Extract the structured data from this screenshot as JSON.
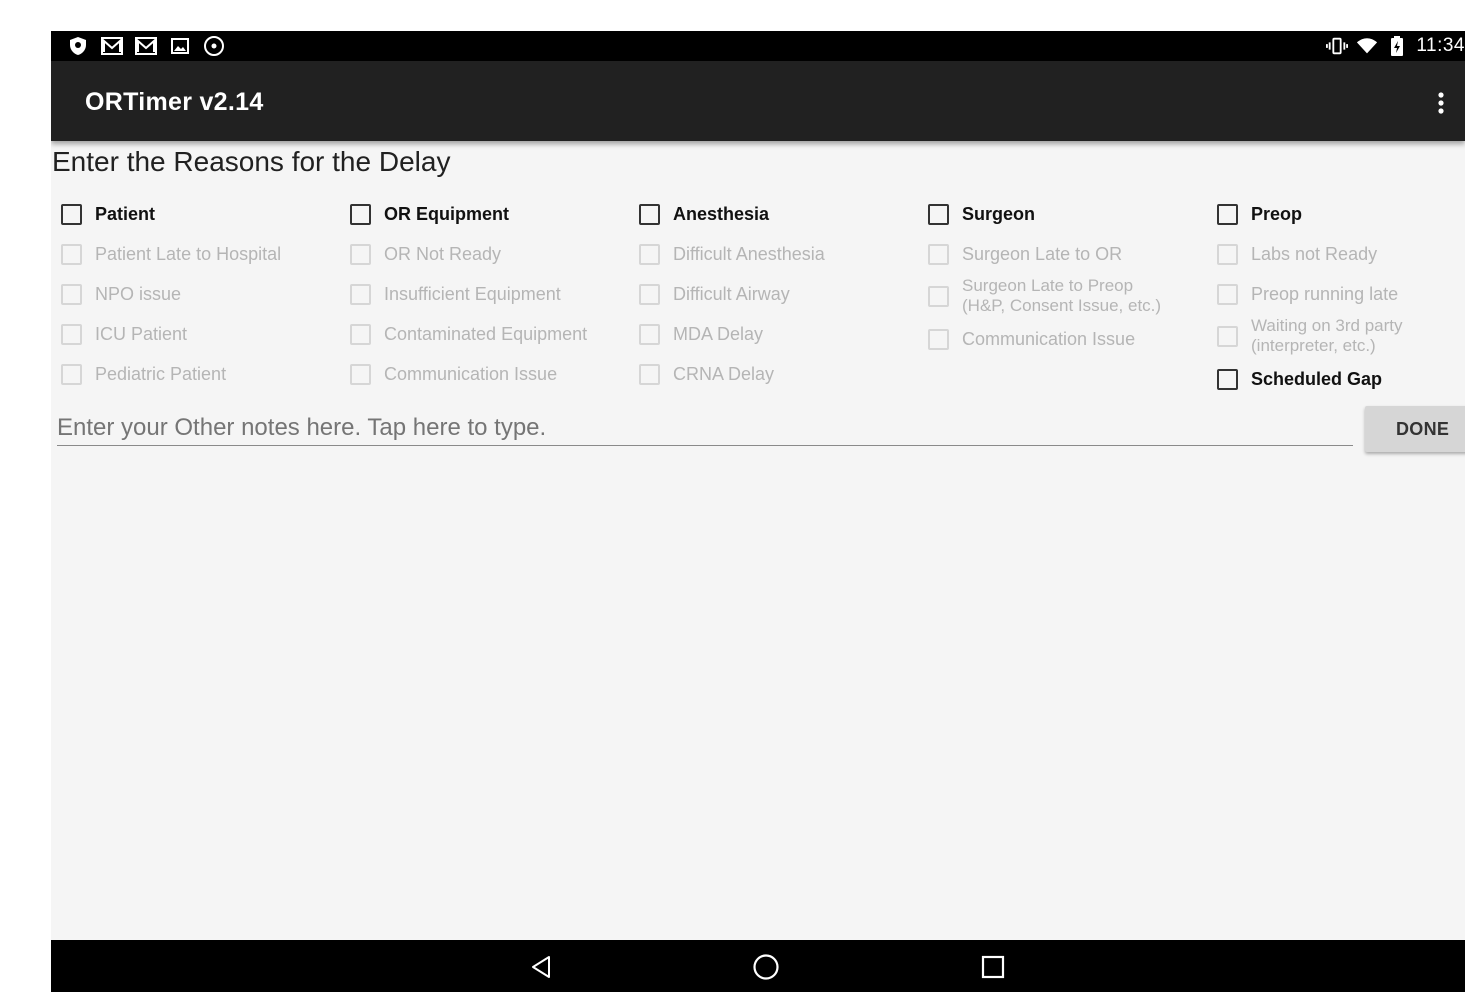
{
  "status_bar": {
    "time": "11:34",
    "left_icons": [
      "shield-icon",
      "gmail-icon",
      "gmail-icon",
      "image-icon",
      "sync-icon"
    ],
    "right_icons": [
      "vibrate-icon",
      "wifi-icon",
      "battery-charging-icon"
    ]
  },
  "app_bar": {
    "title": "ORTimer v2.14",
    "menu_icon": "overflow-menu-icon"
  },
  "heading": "Enter the Reasons for the Delay",
  "columns": [
    {
      "category": "Patient",
      "items": [
        "Patient Late to Hospital",
        "NPO issue",
        "ICU Patient",
        "Pediatric Patient"
      ]
    },
    {
      "category": "OR Equipment",
      "items": [
        "OR Not Ready",
        "Insufficient Equipment",
        "Contaminated Equipment",
        "Communication Issue"
      ]
    },
    {
      "category": "Anesthesia",
      "items": [
        "Difficult Anesthesia",
        "Difficult Airway",
        "MDA Delay",
        "CRNA Delay"
      ]
    },
    {
      "category": "Surgeon",
      "items": [
        "Surgeon Late to OR",
        "Surgeon Late to Preop\n(H&P, Consent Issue, etc.)",
        "Communication Issue"
      ]
    },
    {
      "category": "Preop",
      "items": [
        "Labs not Ready",
        "Preop running late",
        "Waiting on 3rd party\n(interpreter, etc.)"
      ],
      "extra": "Scheduled Gap"
    }
  ],
  "notes": {
    "placeholder": "Enter your Other notes here. Tap here to type.",
    "value": ""
  },
  "done_label": "DONE",
  "nav_bar": [
    "back-icon",
    "home-icon",
    "recents-icon"
  ],
  "colors": {
    "app_bar": "#212121",
    "status_bar": "#000000",
    "background": "#f5f5f5",
    "disabled_text": "#b5b5b5"
  }
}
